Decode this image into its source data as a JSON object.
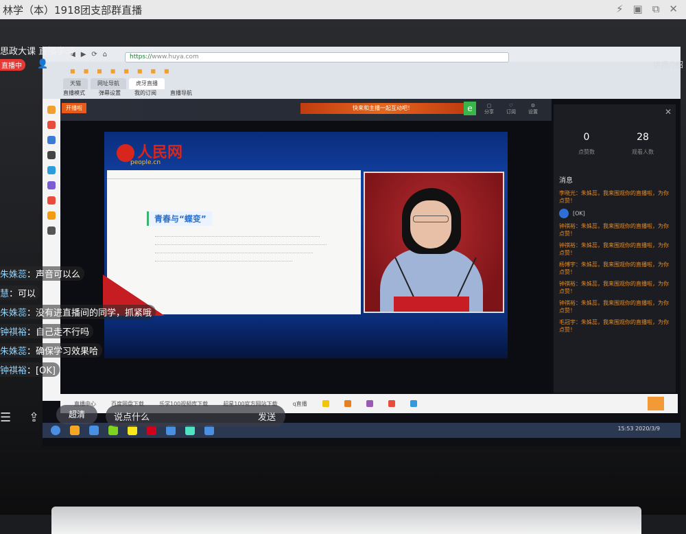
{
  "app": {
    "title": "林学（本）1918团支部群直播",
    "course_title": "思政大课 直播学习",
    "live_badge": "直播中",
    "right_note": "讲师介绍"
  },
  "browser": {
    "url_prefix": "https://",
    "url_domain": "www.huya.com",
    "tabs": [
      "天猫",
      "网址导航",
      "虎牙直播"
    ],
    "subnav": [
      "直播模式",
      "弹幕设置",
      "我的订阅",
      "直播导航"
    ]
  },
  "stream": {
    "header_badge": "开播啦",
    "banner_text": "快来和主播一起互动吧！",
    "header_icons": [
      "分享",
      "订阅",
      "设置"
    ],
    "logo_text": "人民网",
    "logo_sub": "people.cn",
    "slide_heading": "青春与“蝶变”"
  },
  "chat_panel": {
    "stat1_num": "0",
    "stat1_label": "点赞数",
    "stat2_num": "28",
    "stat2_label": "观看人数",
    "messages_title": "消息",
    "messages": [
      {
        "text": "李晓光：朱姝蕊，我来围观你的直播啦，为你点赞！"
      },
      {
        "text": "[OK]"
      },
      {
        "text": "钟祺裕：朱姝蕊，我来围观你的直播啦，为你点赞！"
      },
      {
        "text": "钟祺裕：朱姝蕊，我来围观你的直播啦，为你点赞！"
      },
      {
        "text": "杨博宇：朱姝蕊，我来围观你的直播啦，为你点赞！"
      },
      {
        "text": "钟祺裕：朱姝蕊，我来围观你的直播啦，为你点赞！"
      },
      {
        "text": "钟祺裕：朱姝蕊，我来围观你的直播啦，为你点赞！"
      },
      {
        "text": "毛冠宇：朱姝蕊，我来围观你的直播啦，为你点赞！"
      }
    ]
  },
  "overlay_chat": [
    {
      "name": "朱姝蕊",
      "text": "声音可以么"
    },
    {
      "name": "慧",
      "text": "可以"
    },
    {
      "name": "朱姝蕊",
      "text": "没有进直播间的同学，抓紧哦"
    },
    {
      "name": "钟祺裕",
      "text": "自己走不行吗"
    },
    {
      "name": "朱姝蕊",
      "text": "确保学习效果哈"
    },
    {
      "name": "钟祺裕",
      "text": "[OK]"
    }
  ],
  "controls": {
    "clarity_label": "超清",
    "input_placeholder": "说点什么",
    "send_label": "发送"
  },
  "taskbar": {
    "time": "15:53",
    "date": "2020/3/9"
  },
  "gift_bar_labels": [
    "直播中心",
    "百度网盘下载",
    "乐学100视频库下载",
    "超星100官方网站下载",
    "q直播"
  ]
}
